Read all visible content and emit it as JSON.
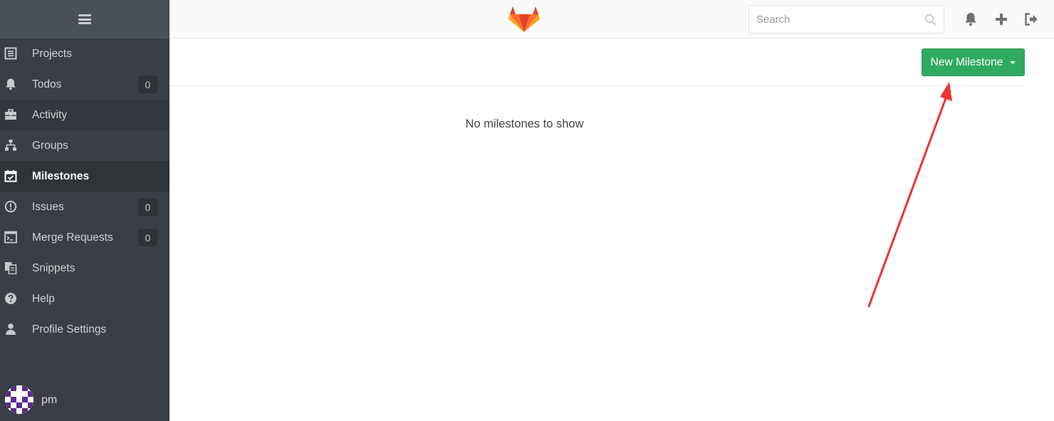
{
  "sidebar": {
    "items": [
      {
        "label": "Projects",
        "icon": "projects-icon"
      },
      {
        "label": "Todos",
        "icon": "bell-icon",
        "badge": "0"
      },
      {
        "label": "Activity",
        "icon": "briefcase-icon"
      },
      {
        "label": "Groups",
        "icon": "sitemap-icon"
      },
      {
        "label": "Milestones",
        "icon": "calendar-check-icon",
        "active": true
      },
      {
        "label": "Issues",
        "icon": "exclamation-circle-icon",
        "badge": "0"
      },
      {
        "label": "Merge Requests",
        "icon": "terminal-icon",
        "badge": "0"
      },
      {
        "label": "Snippets",
        "icon": "copy-icon"
      },
      {
        "label": "Help",
        "icon": "question-circle-icon"
      },
      {
        "label": "Profile Settings",
        "icon": "user-icon"
      }
    ],
    "user": {
      "name": "pm"
    }
  },
  "header": {
    "search": {
      "placeholder": "Search"
    }
  },
  "main": {
    "new_milestone_label": "New Milestone",
    "empty_message": "No milestones to show"
  },
  "colors": {
    "sidebar_bg": "#393f45",
    "primary_button": "#2faa60",
    "annotation_arrow": "#ee3232"
  }
}
